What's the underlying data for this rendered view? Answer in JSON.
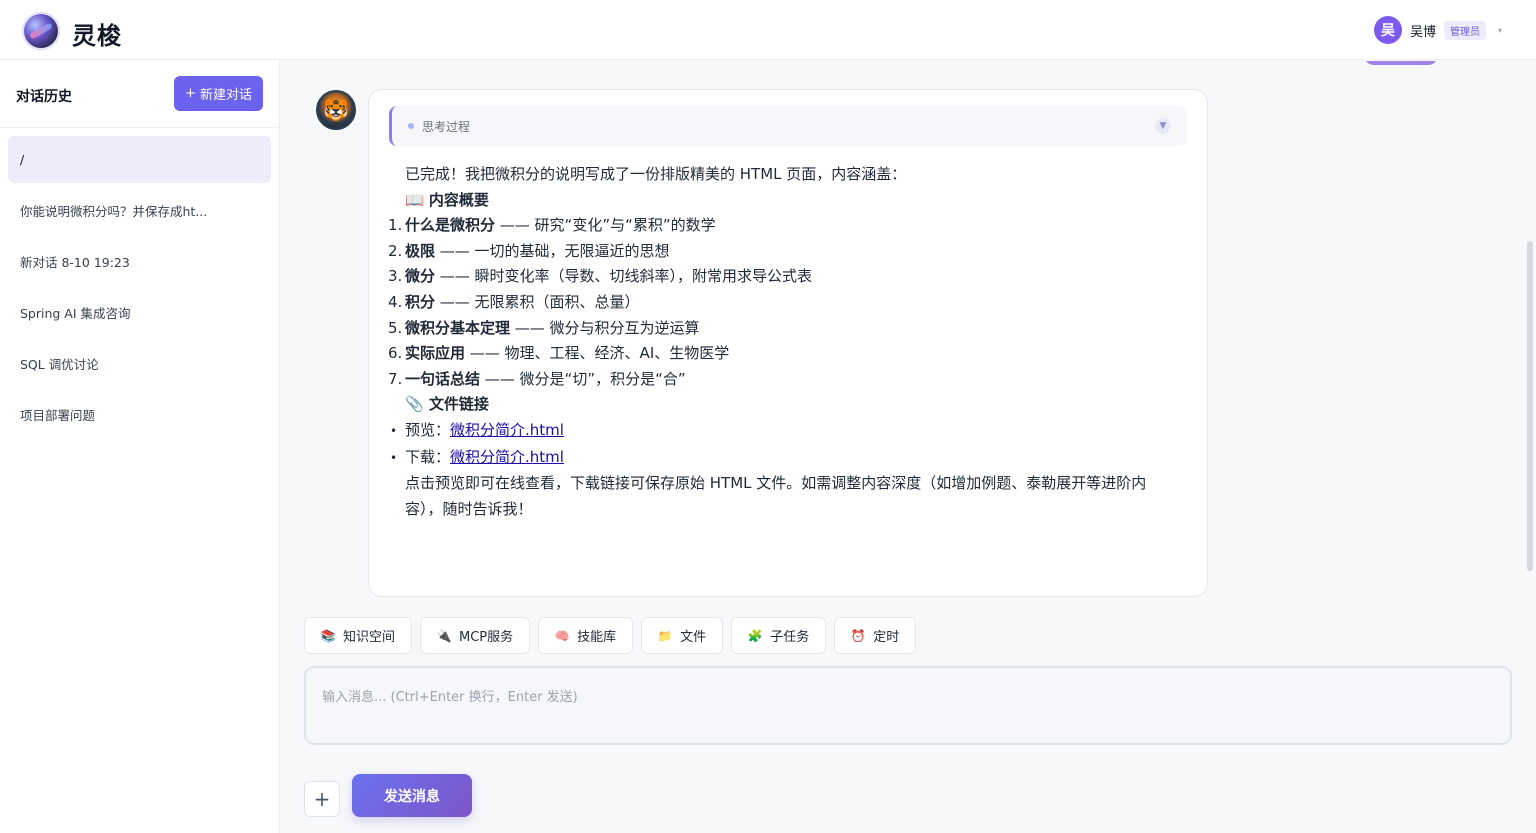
{
  "app": {
    "name": "灵梭",
    "user_initial": "吴",
    "user_name": "吴博",
    "user_role": "管理员",
    "caret": "▾",
    "accent_color": "#6b63f0"
  },
  "sidebar": {
    "title": "对话历史",
    "new_button": "新建对话",
    "new_button_icon": "+",
    "conversations": [
      {
        "label": "/",
        "active": true
      },
      {
        "label": "你能说明微积分吗？并保存成ht...",
        "active": false
      },
      {
        "label": "新对话 8-10 19:23",
        "active": false
      },
      {
        "label": "Spring AI 集成咨询",
        "active": false
      },
      {
        "label": "SQL 调优讨论",
        "active": false
      },
      {
        "label": "项目部署问题",
        "active": false
      }
    ]
  },
  "message": {
    "thinking_label": "思考过程",
    "thinking_toggle": "▼",
    "intro": "已完成！我把微积分的说明写成了一份排版精美的 HTML 页面，内容涵盖：",
    "overview_icon": "📖",
    "overview_heading": "内容概要",
    "items": [
      {
        "num": "1.",
        "bold": "什么是微积分",
        "rest": " —— 研究“变化”与“累积”的数学"
      },
      {
        "num": "2.",
        "bold": "极限",
        "rest": " —— 一切的基础，无限逼近的思想"
      },
      {
        "num": "3.",
        "bold": "微分",
        "rest": " —— 瞬时变化率（导数、切线斜率），附常用求导公式表"
      },
      {
        "num": "4.",
        "bold": "积分",
        "rest": " —— 无限累积（面积、总量）"
      },
      {
        "num": "5.",
        "bold": "微积分基本定理",
        "rest": " —— 微分与积分互为逆运算"
      },
      {
        "num": "6.",
        "bold": "实际应用",
        "rest": " —— 物理、工程、经济、AI、生物医学"
      },
      {
        "num": "7.",
        "bold": "一句话总结",
        "rest": " —— 微分是“切”，积分是“合”"
      }
    ],
    "links_icon": "📎",
    "links_heading": "文件链接",
    "links": [
      {
        "bullet": "•",
        "label": "预览：",
        "link": "微积分简介.html"
      },
      {
        "bullet": "•",
        "label": "下载：",
        "link": "微积分简介.html"
      }
    ],
    "outro": "点击预览即可在线查看，下载链接可保存原始 HTML 文件。如需调整内容深度（如增加例题、泰勒展开等进阶内容），随时告诉我！"
  },
  "tools": [
    {
      "icon": "books-icon",
      "glyph": "📚",
      "label": "知识空间"
    },
    {
      "icon": "plug-icon",
      "glyph": "🔌",
      "label": "MCP服务"
    },
    {
      "icon": "brain-icon",
      "glyph": "🧠",
      "label": "技能库"
    },
    {
      "icon": "folder-icon",
      "glyph": "📁",
      "label": "文件"
    },
    {
      "icon": "puzzle-icon",
      "glyph": "🧩",
      "label": "子任务"
    },
    {
      "icon": "alarm-icon",
      "glyph": "⏰",
      "label": "定时"
    }
  ],
  "composer": {
    "placeholder": "输入消息... (Ctrl+Enter 换行，Enter 发送)",
    "value": "",
    "plus_label": "+",
    "send_label": "发送消息"
  }
}
